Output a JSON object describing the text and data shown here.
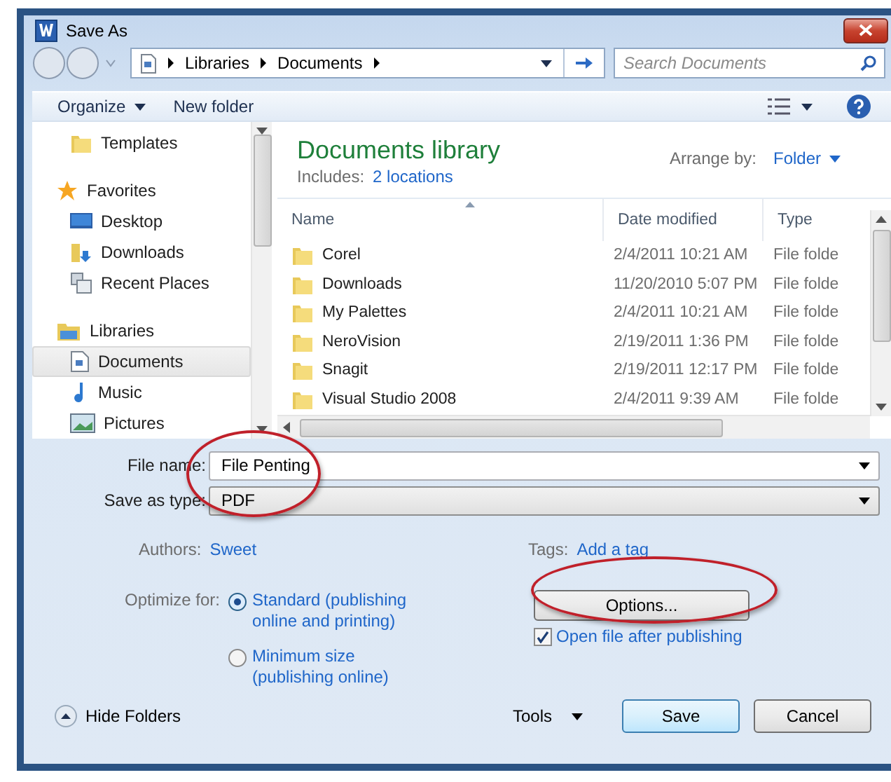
{
  "window": {
    "title": "Save As"
  },
  "address": {
    "crumbs": [
      "Libraries",
      "Documents"
    ]
  },
  "search": {
    "placeholder": "Search Documents"
  },
  "toolbar": {
    "buttons": [
      {
        "label": "Organize",
        "dropdown": true
      },
      {
        "label": "New folder",
        "dropdown": false
      }
    ]
  },
  "nav": {
    "items": [
      {
        "label": "Templates",
        "kind": "item",
        "selected": false
      },
      {
        "label": "Favorites",
        "kind": "header",
        "selected": false
      },
      {
        "label": "Desktop",
        "kind": "item",
        "selected": false
      },
      {
        "label": "Downloads",
        "kind": "item",
        "selected": false
      },
      {
        "label": "Recent Places",
        "kind": "item",
        "selected": false
      },
      {
        "label": "Libraries",
        "kind": "header",
        "selected": false
      },
      {
        "label": "Documents",
        "kind": "item",
        "selected": true
      },
      {
        "label": "Music",
        "kind": "item",
        "selected": false
      },
      {
        "label": "Pictures",
        "kind": "item",
        "selected": false
      }
    ]
  },
  "library": {
    "title": "Documents library",
    "includes_label": "Includes:",
    "includes_link": "2 locations",
    "arrange_label": "Arrange by:",
    "arrange_value": "Folder"
  },
  "table": {
    "columns": [
      "Name",
      "Date modified",
      "Type"
    ],
    "rows": [
      {
        "name": "Corel",
        "date": "2/4/2011 10:21 AM",
        "type": "File folde"
      },
      {
        "name": "Downloads",
        "date": "11/20/2010 5:07 PM",
        "type": "File folde"
      },
      {
        "name": "My Palettes",
        "date": "2/4/2011 10:21 AM",
        "type": "File folde"
      },
      {
        "name": "NeroVision",
        "date": "2/19/2011 1:36 PM",
        "type": "File folde"
      },
      {
        "name": "Snagit",
        "date": "2/19/2011 12:17 PM",
        "type": "File folde"
      },
      {
        "name": "Visual Studio 2008",
        "date": "2/4/2011 9:39 AM",
        "type": "File folde"
      }
    ]
  },
  "form": {
    "file_name": {
      "label": "File name:",
      "value": "File Penting"
    },
    "save_type": {
      "label": "Save as type:",
      "value": "PDF"
    },
    "authors": {
      "label": "Authors:",
      "value": "Sweet"
    },
    "tags": {
      "label": "Tags:",
      "value": "Add a tag"
    },
    "optimize": {
      "label": "Optimize for:",
      "options": [
        {
          "label": "Standard (publishing online and printing)",
          "selected": true
        },
        {
          "label": "Minimum size (publishing online)",
          "selected": false
        }
      ]
    },
    "options_button": "Options...",
    "open_after": {
      "label": "Open file after publishing",
      "checked": true
    }
  },
  "footer": {
    "hide_folders": "Hide Folders",
    "tools": "Tools",
    "buttons": [
      {
        "label": "Save",
        "default": true
      },
      {
        "label": "Cancel",
        "default": false
      }
    ]
  }
}
